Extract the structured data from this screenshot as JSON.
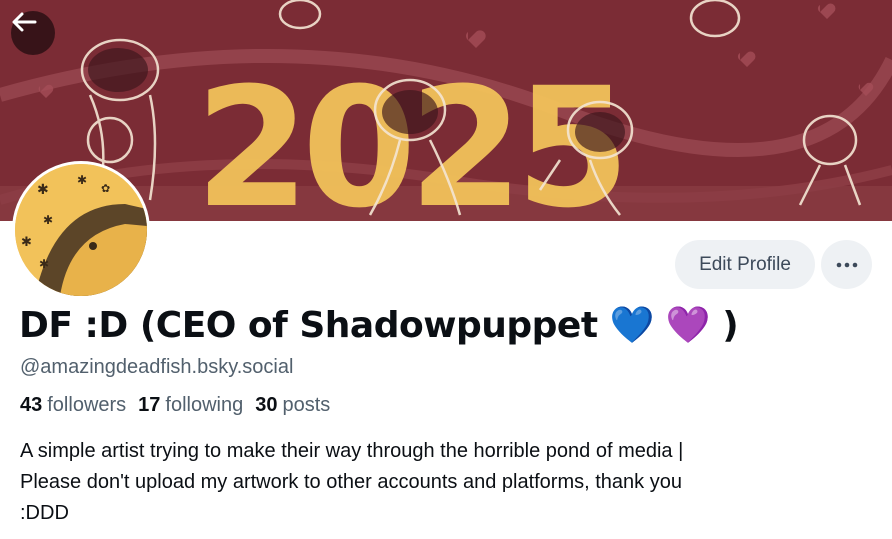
{
  "profile": {
    "display_name": "DF :D (CEO of Shadowpuppet 💙 💜 )",
    "handle": "@amazingdeadfish.bsky.social",
    "stats": {
      "followers_count": "43",
      "followers_label": "followers",
      "following_count": "17",
      "following_label": "following",
      "posts_count": "30",
      "posts_label": "posts"
    },
    "bio_lines": [
      "A simple artist trying to make their way through the horrible pond of media |",
      "Please don't upload my artwork to other accounts and platforms, thank you",
      ":DDD"
    ]
  },
  "actions": {
    "edit_profile_label": "Edit Profile",
    "more_icon": "ellipsis-icon",
    "back_icon": "arrow-left-icon"
  },
  "banner": {
    "year_text": "2025",
    "background_color": "#7b2c35",
    "accent_color": "#f2c25a"
  },
  "colors": {
    "button_bg": "#eef1f4",
    "muted_text": "#52606d",
    "primary_text": "#0b0f14"
  }
}
